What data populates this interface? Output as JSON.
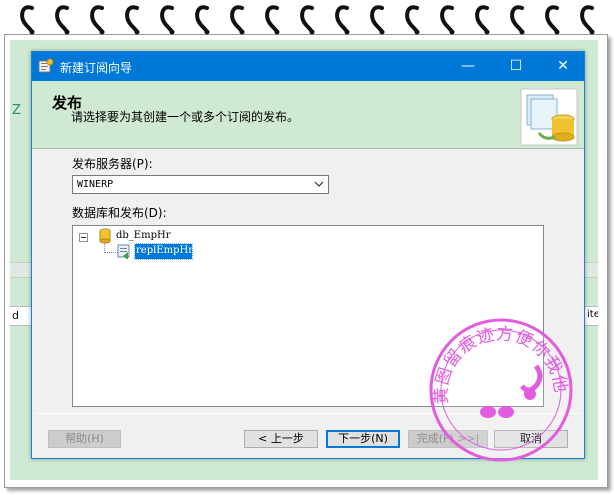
{
  "left_edge": {
    "text_z": "Z",
    "text_d": "d",
    "text_right": "ite"
  },
  "dialog": {
    "title": "新建订阅向导",
    "window_controls": {
      "minimize": "—",
      "maximize": "☐",
      "close": "✕"
    }
  },
  "header": {
    "title": "发布",
    "subtitle": "请选择要为其创建一个或多个订阅的发布。"
  },
  "publisher": {
    "label": "发布服务器(P):",
    "selected": "WINERP"
  },
  "databases": {
    "label": "数据库和发布(D):",
    "tree": {
      "database": "db_EmpHr",
      "publication": "replEmpHr"
    }
  },
  "buttons": {
    "help": "帮助(H)",
    "back": "< 上一步",
    "next": "下一步(N)",
    "finish": "完成(F) >>|",
    "cancel": "取消"
  },
  "watermark": {
    "text": "黄图留痕迹方便你我他"
  }
}
